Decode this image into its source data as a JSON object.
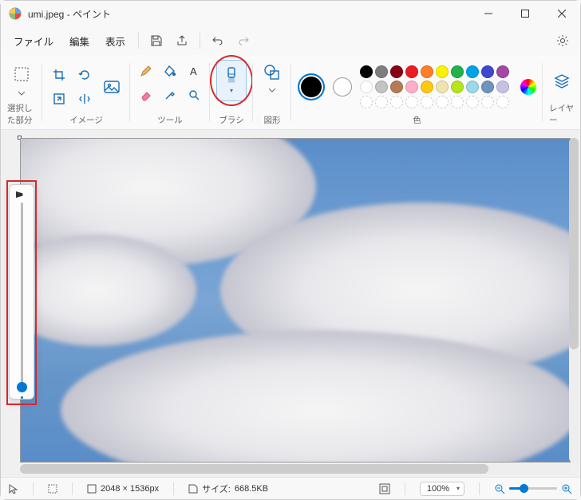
{
  "titlebar": {
    "filename": "umi.jpeg",
    "app": "ペイント"
  },
  "menus": {
    "file": "ファイル",
    "edit": "編集",
    "view": "表示"
  },
  "ribbon": {
    "selection": "選択した部分",
    "image": "イメージ",
    "tools": "ツール",
    "brushes": "ブラシ",
    "shapes": "図形",
    "colors": "色",
    "layers": "レイヤー"
  },
  "palette_row1": [
    "#000000",
    "#7e7e7e",
    "#870014",
    "#ec1c23",
    "#ff7e26",
    "#fef200",
    "#22b14c",
    "#00a2e8",
    "#3f47cc",
    "#a349a3"
  ],
  "palette_row2": [
    "#ffffff",
    "#c3c3c3",
    "#b87957",
    "#feaec9",
    "#ffc90d",
    "#efe4b0",
    "#b5e61d",
    "#99d9ea",
    "#7092be",
    "#c8bfe6"
  ],
  "status": {
    "dimensions_label": "2048 × 1536px",
    "size_prefix": "サイズ:",
    "size_value": "668.5KB",
    "zoom": "100%"
  }
}
